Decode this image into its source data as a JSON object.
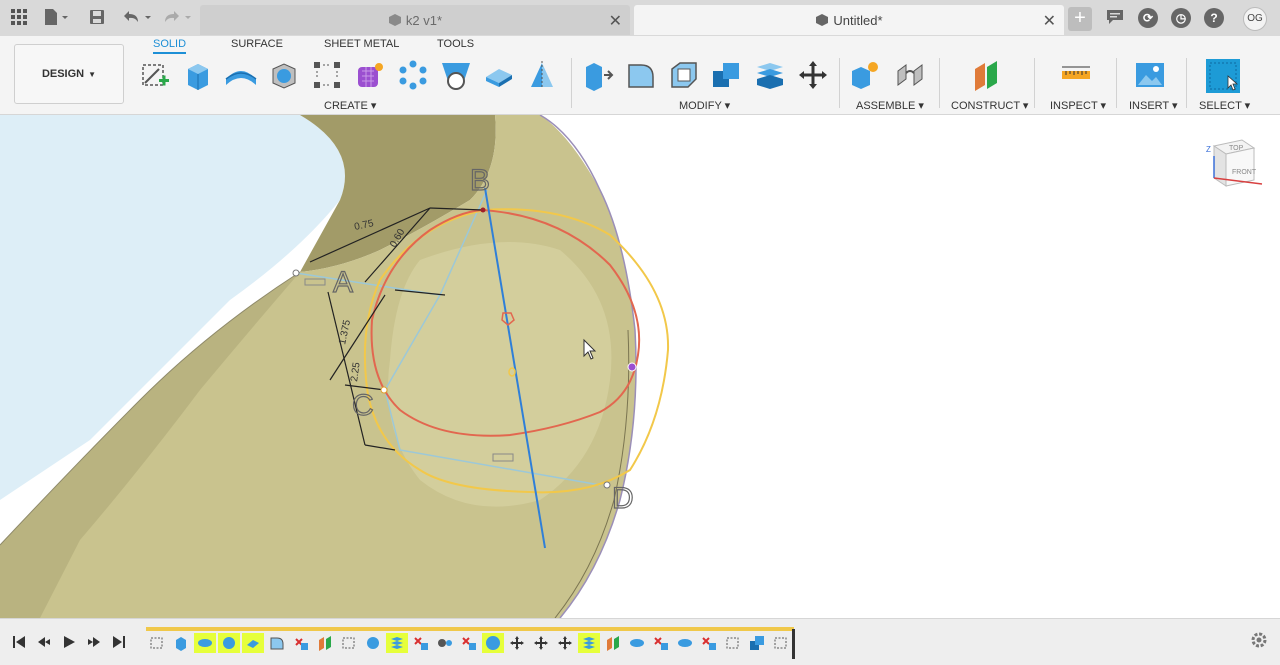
{
  "title_bar": {
    "tabs": [
      {
        "label": "k2 v1*",
        "active": false
      },
      {
        "label": "Untitled*",
        "active": true
      }
    ],
    "user_initials": "OG",
    "icons": [
      "app-grid-icon",
      "file-icon",
      "save-icon",
      "undo-icon",
      "redo-icon",
      "new-tab-icon",
      "chat-icon",
      "job-status-icon",
      "clock-icon",
      "help-icon"
    ]
  },
  "ribbon": {
    "workspace": "DESIGN",
    "tabs": [
      "SOLID",
      "SURFACE",
      "SHEET METAL",
      "TOOLS"
    ],
    "active_tab": "SOLID",
    "groups": [
      "CREATE",
      "MODIFY",
      "ASSEMBLE",
      "CONSTRUCT",
      "INSPECT",
      "INSERT",
      "SELECT"
    ],
    "accent_color": "#1d8fd6"
  },
  "viewport": {
    "sketch_labels": [
      "B",
      "A",
      "C",
      "D"
    ],
    "dimensions": [
      "0.75",
      "0.60",
      "1.375",
      "2.25"
    ],
    "viewcube": {
      "top": "TOP",
      "front": "FRONT",
      "axis": "Z"
    },
    "colors": {
      "body": "#c9c38e",
      "ring_dark": "#9d9566",
      "inner_face": "#ddeef7",
      "red_circle": "#e2674f",
      "yellow_circle": "#f2c84a",
      "axis_line": "#2f7fd8"
    }
  },
  "timeline": {
    "controls": [
      "skip-to-start-icon",
      "step-back-icon",
      "play-icon",
      "step-forward-icon",
      "skip-to-end-icon"
    ],
    "feature_count": 27
  }
}
